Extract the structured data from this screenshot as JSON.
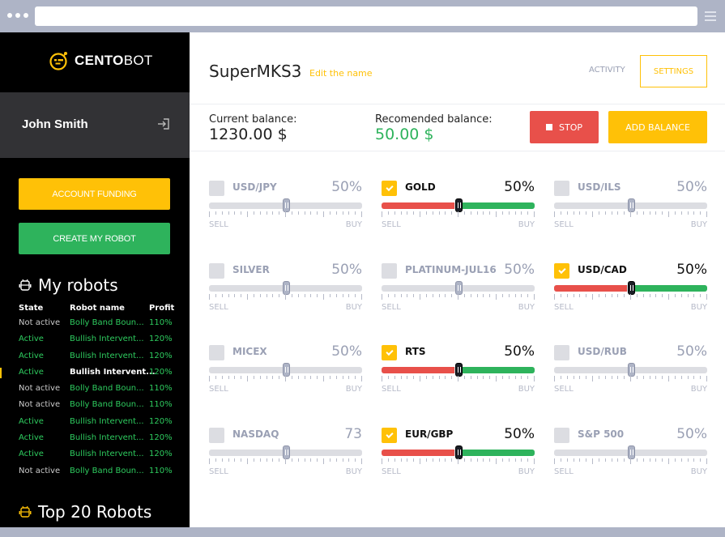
{
  "browser": {
    "menu_icon": "hamburger-icon",
    "window_dots_icon": "window-dots-icon"
  },
  "sidebar": {
    "logo": {
      "icon": "robot-face-icon",
      "text_bold": "CENTO",
      "text_thin": "BOT"
    },
    "user": {
      "name": "John Smith",
      "logout_icon": "logout-icon"
    },
    "buttons": {
      "account_funding": "ACCOUNT FUNDING",
      "create_robot": "CREATE MY ROBOT"
    },
    "my_robots": {
      "title": "My robots",
      "icon": "robot-icon",
      "columns": [
        "State",
        "Robot name",
        "Profit"
      ],
      "rows": [
        {
          "state": "Not active",
          "name": "Bolly Band Boun...",
          "profit": "110%",
          "active": false,
          "selected": false
        },
        {
          "state": "Active",
          "name": "Bullish Intervent...",
          "profit": "120%",
          "active": true,
          "selected": false
        },
        {
          "state": "Active",
          "name": "Bullish Intervent...",
          "profit": "120%",
          "active": true,
          "selected": false
        },
        {
          "state": "Active",
          "name": "Bullish Intervent...",
          "profit": "120%",
          "active": true,
          "selected": true
        },
        {
          "state": "Not active",
          "name": "Bolly Band Boun...",
          "profit": "110%",
          "active": false,
          "selected": false
        },
        {
          "state": "Not active",
          "name": "Bolly Band Boun...",
          "profit": "110%",
          "active": false,
          "selected": false
        },
        {
          "state": "Active",
          "name": "Bullish Intervent...",
          "profit": "120%",
          "active": true,
          "selected": false
        },
        {
          "state": "Active",
          "name": "Bullish Intervent...",
          "profit": "120%",
          "active": true,
          "selected": false
        },
        {
          "state": "Active",
          "name": "Bullish Intervent...",
          "profit": "120%",
          "active": true,
          "selected": false
        },
        {
          "state": "Not active",
          "name": "Bolly Band Boun...",
          "profit": "110%",
          "active": false,
          "selected": false
        }
      ]
    },
    "top_robots": {
      "title": "Top 20 Robots",
      "icon": "robot-icon"
    }
  },
  "main": {
    "robot_name": "SuperMKS3",
    "edit_name_link": "Edit the name",
    "tabs": {
      "activity": "ACTIVITY",
      "settings": "SETTINGS"
    },
    "balance": {
      "current_label": "Current balance:",
      "current_value": "1230.00 $",
      "recommended_label": "Recomended balance:",
      "recommended_value": "50.00 $"
    },
    "buttons": {
      "stop": "STOP",
      "add_balance": "ADD BALANCE"
    },
    "slider_labels": {
      "sell": "SELL",
      "buy": "BUY"
    },
    "instruments": [
      {
        "name": "USD/JPY",
        "percent_label": "50%",
        "checked": false,
        "position": 0.5
      },
      {
        "name": "GOLD",
        "percent_label": "50%",
        "checked": true,
        "position": 0.5
      },
      {
        "name": "USD/ILS",
        "percent_label": "50%",
        "checked": false,
        "position": 0.5
      },
      {
        "name": "SILVER",
        "percent_label": "50%",
        "checked": false,
        "position": 0.5
      },
      {
        "name": "PLATINUM-JUL16",
        "percent_label": "50%",
        "checked": false,
        "position": 0.5
      },
      {
        "name": "USD/CAD",
        "percent_label": "50%",
        "checked": true,
        "position": 0.5
      },
      {
        "name": "MICEX",
        "percent_label": "50%",
        "checked": false,
        "position": 0.5
      },
      {
        "name": "RTS",
        "percent_label": "50%",
        "checked": true,
        "position": 0.5
      },
      {
        "name": "USD/RUB",
        "percent_label": "50%",
        "checked": false,
        "position": 0.5
      },
      {
        "name": "NASDAQ",
        "percent_label": "73",
        "checked": false,
        "position": 0.5
      },
      {
        "name": "EUR/GBP",
        "percent_label": "50%",
        "checked": true,
        "position": 0.5
      },
      {
        "name": "S&P 500",
        "percent_label": "50%",
        "checked": false,
        "position": 0.5
      }
    ]
  },
  "colors": {
    "accent_yellow": "#ffc107",
    "green": "#2eb35c",
    "red": "#e8504a",
    "muted": "#9aa0b4"
  }
}
